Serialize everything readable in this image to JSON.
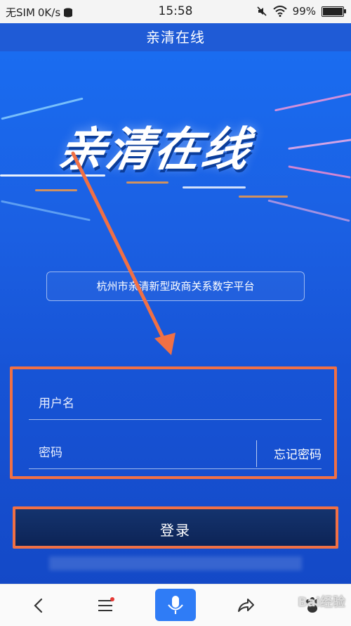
{
  "status_bar": {
    "carrier": "无SIM",
    "speed": "0K/s",
    "time": "15:58",
    "battery": "99%"
  },
  "header": {
    "title": "亲清在线"
  },
  "hero": {
    "logo_text": "亲清在线",
    "subtitle": "杭州市亲清新型政商关系数字平台"
  },
  "form": {
    "username_placeholder": "用户名",
    "password_placeholder": "密码",
    "forgot_label": "忘记密码",
    "login_label": "登录"
  },
  "bottom_nav": {
    "back_icon": "chevron-left-icon",
    "menu_icon": "menu-icon",
    "mic_icon": "microphone-icon",
    "share_icon": "share-icon",
    "baidu_icon": "paw-icon"
  },
  "watermark": "Bai经验",
  "colors": {
    "header_blue": "#1f5bd6",
    "highlight_orange": "#f07045",
    "login_dark": "#0d2456",
    "mic_blue": "#2f7cf6"
  }
}
